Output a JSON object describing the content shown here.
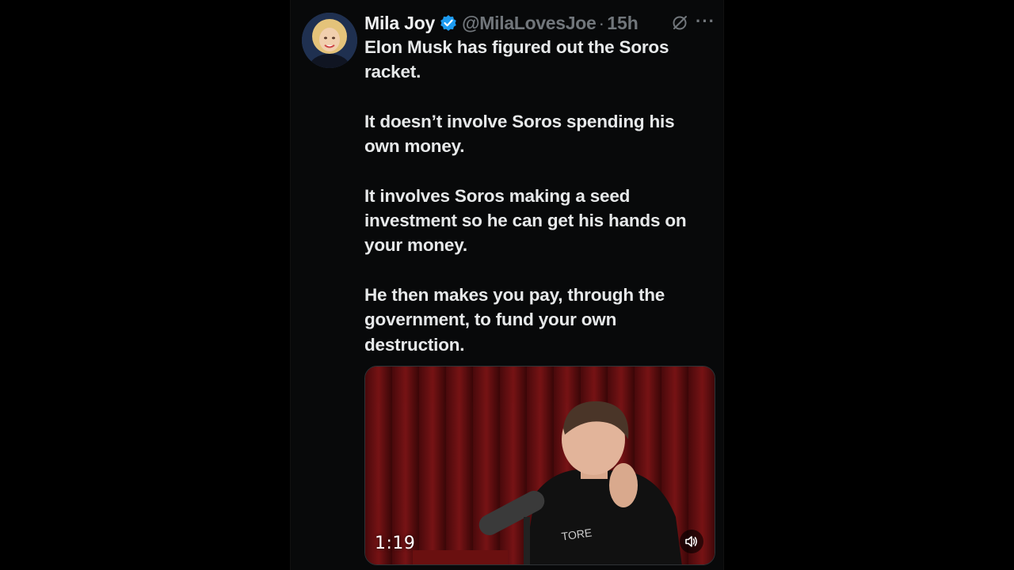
{
  "tweet": {
    "author_name": "Mila Joy",
    "handle": "@MilaLovesJoe",
    "separator": "·",
    "time": "15h",
    "verified": true,
    "paragraphs": [
      "Elon Musk has figured out the Soros racket.",
      "It doesn’t involve Soros spending his own money.",
      "It involves Soros making a seed investment so he can get his hands on your money.",
      "He then makes you pay, through the government, to fund your own destruction."
    ]
  },
  "media": {
    "duration": "1:19",
    "mute_icon": "speaker-icon"
  },
  "colors": {
    "background": "#000000",
    "text": "#e7e9ea",
    "secondary": "#71767b",
    "verified_blue": "#1d9bf0"
  }
}
